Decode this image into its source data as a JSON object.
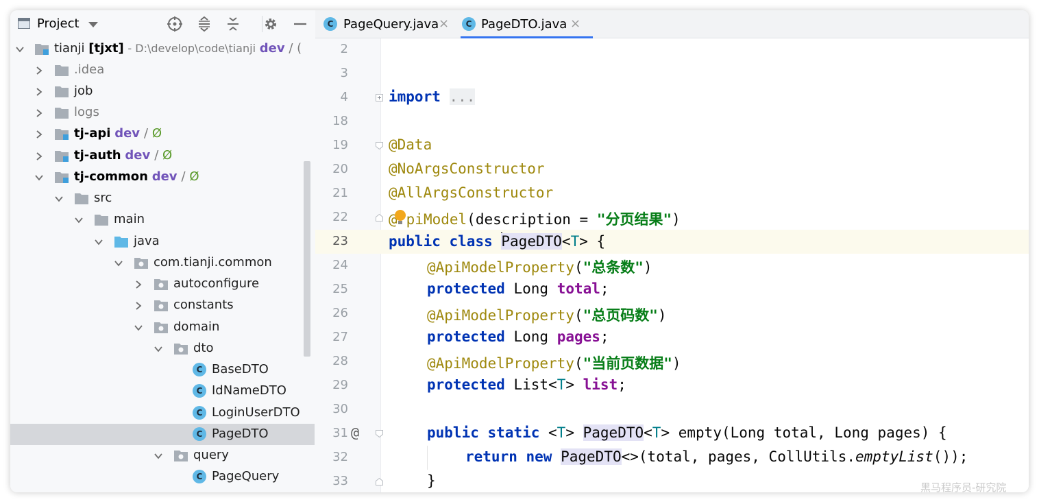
{
  "project_panel": {
    "title": "Project",
    "toolbar_icons": [
      "crosshair-icon",
      "expand-all-icon",
      "collapse-all-icon",
      "gear-icon",
      "minimize-icon"
    ],
    "root": {
      "name": "tianji",
      "module": "[tjxt]",
      "path": "- D:\\develop\\code\\tianji",
      "branch": "dev",
      "branch_sep": "/",
      "branch_tail": "("
    },
    "items": {
      "idea": ".idea",
      "job": "job",
      "logs": "logs",
      "tj_api": {
        "name": "tj-api",
        "branch": "dev",
        "sep": "/",
        "status": "Ø"
      },
      "tj_auth": {
        "name": "tj-auth",
        "branch": "dev",
        "sep": "/",
        "status": "Ø"
      },
      "tj_common": {
        "name": "tj-common",
        "branch": "dev",
        "sep": "/",
        "status": "Ø"
      },
      "src": "src",
      "main": "main",
      "java": "java",
      "pkg": "com.tianji.common",
      "autoconfigure": "autoconfigure",
      "constants": "constants",
      "domain": "domain",
      "dto": "dto",
      "base_dto": "BaseDTO",
      "id_name_dto": "IdNameDTO",
      "login_user_dto": "LoginUserDTO",
      "page_dto": "PageDTO",
      "query": "query",
      "page_query": "PageQuery"
    },
    "class_icon_letter": "C"
  },
  "editor": {
    "tabs": [
      {
        "label": "PageQuery.java",
        "close": "×",
        "active": false
      },
      {
        "label": "PageDTO.java",
        "close": "×",
        "active": true
      }
    ],
    "lines": {
      "l2": "2",
      "l3": "3",
      "l4": "4",
      "l18": "18",
      "l19": "19",
      "l20": "20",
      "l21": "21",
      "l22": "22",
      "l23": "23",
      "l24": "24",
      "l25": "25",
      "l26": "26",
      "l27": "27",
      "l28": "28",
      "l29": "29",
      "l30": "30",
      "l31": "31",
      "l32": "32",
      "l33": "33"
    },
    "code": {
      "import_kw": "import",
      "import_fold": "...",
      "ann_data": "@Data",
      "ann_noargs": "@NoArgsConstructor",
      "ann_allargs": "@AllArgsConstructor",
      "ann_apimodel_at": "@",
      "ann_apimodel_rest": "piModel",
      "apimodel_args": "(description = ",
      "apimodel_str": "\"分页结果\"",
      "apimodel_close": ")",
      "public": "public",
      "class": "class",
      "class_name": "PageDTO",
      "type_open": "<",
      "type_param": "T",
      "type_close": ">",
      "brace_open": " {",
      "amp_1": "@ApiModelProperty",
      "amp_1_str": "\"总条数\"",
      "protected": "protected",
      "long_type": "Long",
      "field_total": "total",
      "amp_2": "@ApiModelProperty",
      "amp_2_str": "\"总页码数\"",
      "field_pages": "pages",
      "amp_3": "@ApiModelProperty",
      "amp_3_str": "\"当前页数据\"",
      "list_type": "List",
      "field_list": "list",
      "static": "static",
      "method_empty": "empty(Long total, Long pages) {",
      "return": "return",
      "new": "new",
      "ctor_args": "<>(total, pages, CollUtils.",
      "empty_list": "emptyList",
      "ctor_end": "());",
      "brace_close": "}",
      "at_marker": "@"
    }
  },
  "watermark": "黑马程序员-研究院"
}
